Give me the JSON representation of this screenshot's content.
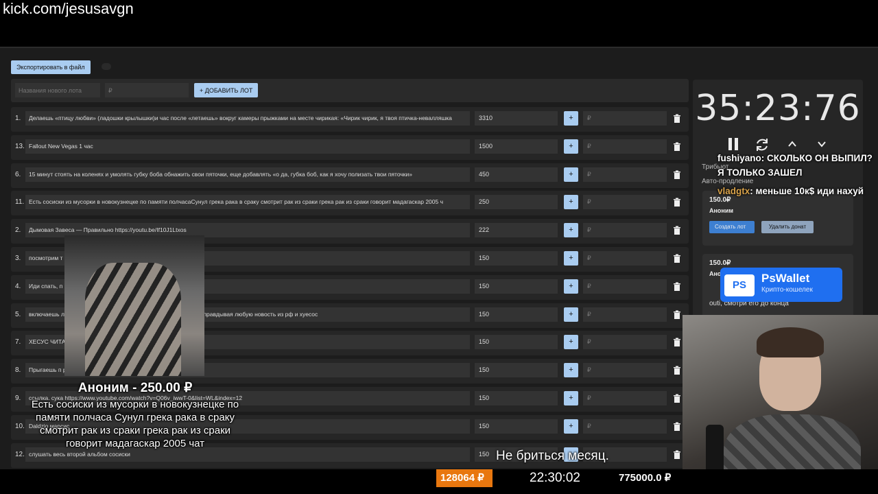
{
  "stream_url": "kick.com/jesusavgn",
  "toolbar": {
    "export_label": "Экспортировать в файл"
  },
  "add_lot": {
    "name_placeholder": "Названия нового лота",
    "price_placeholder": "₽",
    "add_label": "+ ДОБАВИТЬ ЛОТ"
  },
  "lots": [
    {
      "num": "1.",
      "name": "Делаешь «птицу любви» (ладошки крылышки)и час после «летаешь» вокруг камеры прыжками на месте чирикая: «Чирик чирик, я твоя птичка-невалляшка",
      "amount": "3310",
      "plus": "+",
      "price": "₽"
    },
    {
      "num": "13.",
      "name": "Fallout New Vegas 1 час",
      "amount": "1500",
      "plus": "+",
      "price": "₽"
    },
    {
      "num": "6.",
      "name": "15 минут стоять на коленях и умолять губку боба обнажить свои пяточки, еще добавлять «о да, губка боб, как я хочу полизать твои пяточки»",
      "amount": "450",
      "plus": "+",
      "price": "₽"
    },
    {
      "num": "11.",
      "name": "Есть сосиски из мусорки в новокузнецке по памяти полчасаСунул грека рака в сраку смотрит рак из сраки грека рак из сраки говорит мадагаскар 2005 ч",
      "amount": "250",
      "plus": "+",
      "price": "₽"
    },
    {
      "num": "2.",
      "name": "Дымовая Завеса — Правильно https://youtu.be/If10J1Ltxos",
      "amount": "222",
      "plus": "+",
      "price": "₽"
    },
    {
      "num": "3.",
      "name": "посмотрим т",
      "amount": "150",
      "plus": "+",
      "price": "₽"
    },
    {
      "num": "4.",
      "name": "Иди спать, п",
      "amount": "150",
      "plus": "+",
      "price": "₽"
    },
    {
      "num": "5.",
      "name": "включаешь л                                                            елаешь реакт на него как будто ты лютый зетник оправдывая любую новость из рф и хуесос",
      "amount": "150",
      "plus": "+",
      "price": "₽"
    },
    {
      "num": "7.",
      "name": "ХЕСУС ЧИТА",
      "amount": "150",
      "plus": "+",
      "price": "₽"
    },
    {
      "num": "8.",
      "name": "Прыгаешь п                                                              ришь на пятку и продолжаешь",
      "amount": "150",
      "plus": "+",
      "price": "₽"
    },
    {
      "num": "9.",
      "name": "ссылка. сука https://www.youtube.com/watch?v=Q06v_iwwT-0&list=WL&index=12",
      "amount": "150",
      "plus": "+",
      "price": "₽"
    },
    {
      "num": "10.",
      "name": "Daldzio марсис",
      "amount": "150",
      "plus": "+",
      "price": "₽"
    },
    {
      "num": "12.",
      "name": "слушать весь второй альбом сосиски",
      "amount": "150",
      "plus": "+",
      "price": "₽"
    }
  ],
  "timer": {
    "value": "35:23:76"
  },
  "settings": {
    "tribute_label": "Трибьют",
    "autoprod_label": "Авто-продление"
  },
  "donations": [
    {
      "amount": "150.0₽",
      "who": "Аноним",
      "create_label": "Создать лот",
      "delete_label": "Удалить донат"
    },
    {
      "amount": "150.0₽",
      "who": "Ано",
      "message_tail": "outi, смотри его до конца"
    }
  ],
  "chat": [
    {
      "user": "fushiyano",
      "text": ": СКОЛЬКО ОН ВЫПИЛ? Я ТОЛЬКО ЗАШЕЛ"
    },
    {
      "user": "vladgtx",
      "text": ": меньше 10к$ иди нахуй"
    }
  ],
  "pswallet": {
    "logo": "PS",
    "title": "PsWallet",
    "subtitle": "Крипто-кошелек"
  },
  "donation_alert": {
    "title": "Аноним - 250.00 ₽",
    "message": "Есть сосиски из мусорки в новокузнецке по памяти полчаса Сунул грека рака в сраку смотрит рак из сраки грека рак из сраки говорит мадагаскар 2005 чат"
  },
  "subtitle": "Не бриться месяц.",
  "status": {
    "total": "128064 ₽",
    "clock": "22:30:02",
    "goal": "775000.0 ₽"
  },
  "colors": {
    "accent_button": "#a9ccf0",
    "status_orange": "#e8770f",
    "pswallet_blue": "#1f6ff0"
  }
}
